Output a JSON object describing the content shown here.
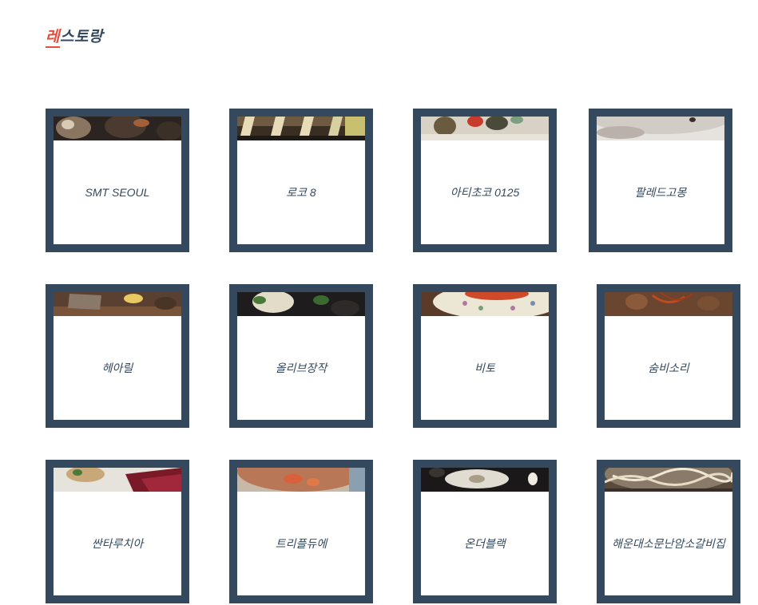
{
  "header": {
    "title_accent": "레",
    "title_rest": "스토랑"
  },
  "restaurants": [
    {
      "name": "SMT SEOUL"
    },
    {
      "name": "로코 8"
    },
    {
      "name": "아티초코 0125"
    },
    {
      "name": "팔레드고몽"
    },
    {
      "name": "헤아릴"
    },
    {
      "name": "올리브장작"
    },
    {
      "name": "비토"
    },
    {
      "name": "숨비소리"
    },
    {
      "name": "싼타루치아"
    },
    {
      "name": "트리플듀에"
    },
    {
      "name": "온더블랙"
    },
    {
      "name": "해운대소문난암소갈비집"
    }
  ]
}
